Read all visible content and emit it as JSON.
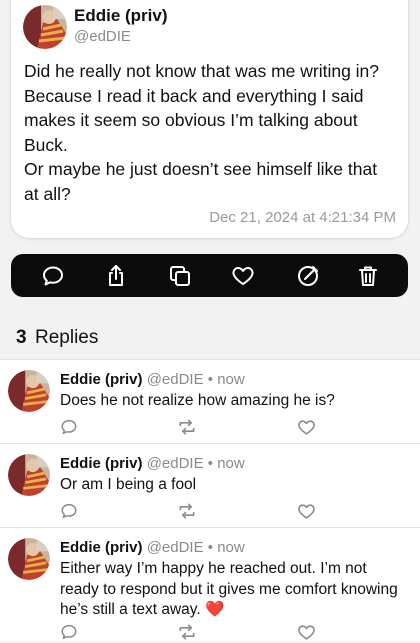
{
  "post": {
    "author_name": "Eddie (priv)",
    "author_handle": "@edDIE",
    "body_lines": [
      "Did he really not know that was me writing in? Because I read it back and everything I said makes it seem so obvious I’m talking about Buck.",
      "Or maybe he just doesn’t see himself like that at all?"
    ],
    "timestamp": "Dec 21, 2024 at 4:21:34 PM"
  },
  "toolbar": {
    "icons": [
      "comment-icon",
      "share-icon",
      "copy-icon",
      "heart-icon",
      "edit-icon",
      "trash-icon"
    ]
  },
  "replies_header": {
    "count": "3",
    "label": "Replies"
  },
  "replies": [
    {
      "name": "Eddie (priv)",
      "handle": "@edDIE",
      "separator": "•",
      "time": "now",
      "text": "Does he not realize how amazing he is?"
    },
    {
      "name": "Eddie (priv)",
      "handle": "@edDIE",
      "separator": "•",
      "time": "now",
      "text": "Or am I being a fool"
    },
    {
      "name": "Eddie (priv)",
      "handle": "@edDIE",
      "separator": "•",
      "time": "now",
      "text": "Either way I’m happy he reached out. I’m not ready to respond but it gives me comfort knowing he’s still a text away.",
      "emoji": "❤️"
    }
  ],
  "colors": {
    "toolbar_bg": "#0b0b0b",
    "muted": "#8a8a8e",
    "emoji_heart": "#e0202a"
  }
}
